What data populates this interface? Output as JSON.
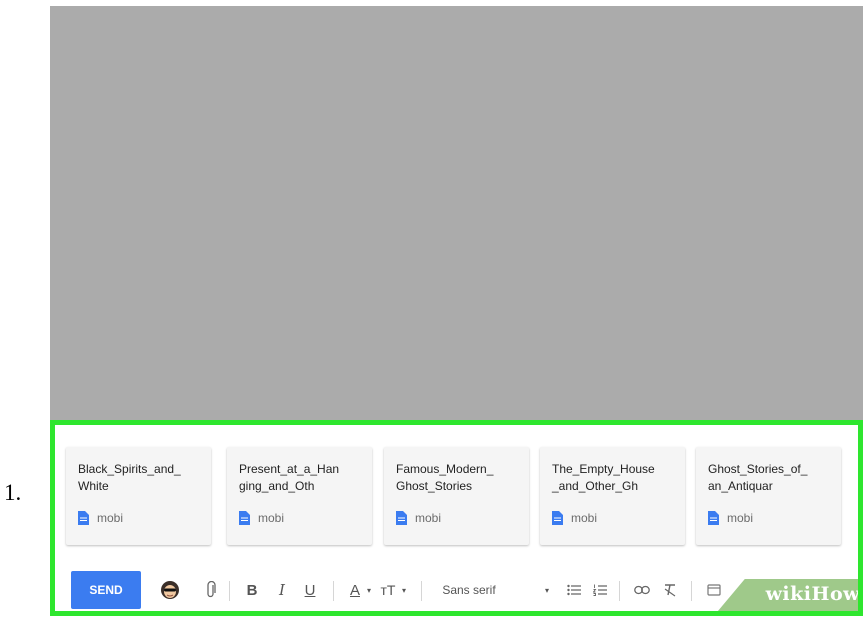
{
  "step": {
    "number": "1."
  },
  "attachments": [
    {
      "name": "Black_Spirits_and_\nWhite",
      "type": "mobi"
    },
    {
      "name": "Present_at_a_Han\nging_and_Oth",
      "type": "mobi"
    },
    {
      "name": "Famous_Modern_\nGhost_Stories",
      "type": "mobi"
    },
    {
      "name": "The_Empty_House\n_and_Other_Gh",
      "type": "mobi"
    },
    {
      "name": "Ghost_Stories_of_\nan_Antiquar",
      "type": "mobi"
    }
  ],
  "toolbar": {
    "send_label": "SEND",
    "bold_label": "B",
    "italic_label": "I",
    "underline_label": "U",
    "text_color_label": "A",
    "font_size_label": "тT",
    "font_label": "Sans serif"
  },
  "watermark": {
    "text": "wikiHow"
  },
  "colors": {
    "highlight": "#2ee62e",
    "send": "#3b7cf0",
    "file_icon": "#3b7cf0",
    "gray_area": "#ababab"
  },
  "icons": [
    "emoji-icon",
    "paperclip-icon",
    "chevron-down-icon",
    "bulleted-list-icon",
    "numbered-list-icon",
    "link-icon",
    "clear-formatting-icon",
    "more-icon"
  ]
}
